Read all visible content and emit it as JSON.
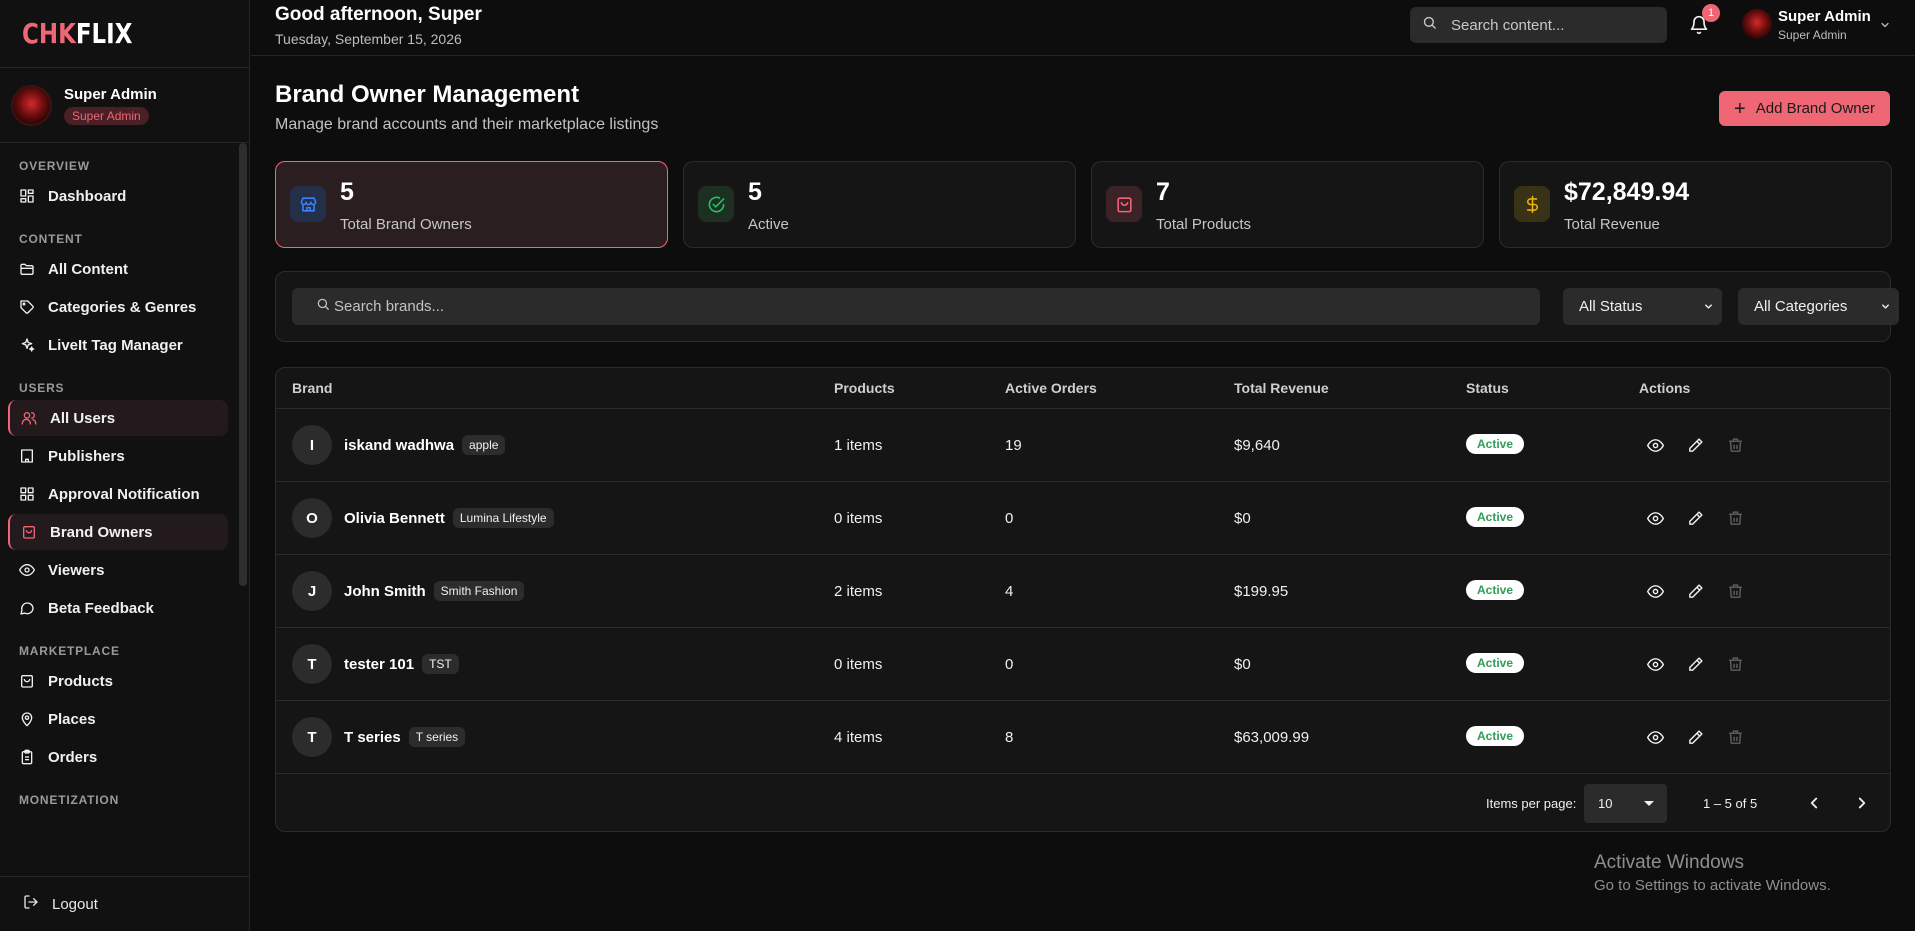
{
  "brand": {
    "logo_part1": "CHK",
    "logo_part2": "FLIX"
  },
  "profile": {
    "name": "Super Admin",
    "role": "Super Admin"
  },
  "sidebar": {
    "sections": [
      {
        "title": "OVERVIEW",
        "items": [
          {
            "label": "Dashboard",
            "icon": "dashboard-icon"
          }
        ]
      },
      {
        "title": "CONTENT",
        "items": [
          {
            "label": "All Content",
            "icon": "folder-icon"
          },
          {
            "label": "Categories & Genres",
            "icon": "tag-icon"
          },
          {
            "label": "LiveIt Tag Manager",
            "icon": "sparkles-icon"
          }
        ]
      },
      {
        "title": "USERS",
        "items": [
          {
            "label": "All Users",
            "icon": "users-icon"
          },
          {
            "label": "Publishers",
            "icon": "building-icon"
          },
          {
            "label": "Approval Notification",
            "icon": "grid-icon"
          },
          {
            "label": "Brand Owners",
            "icon": "shopping-bag-icon"
          },
          {
            "label": "Viewers",
            "icon": "eye-icon"
          },
          {
            "label": "Beta Feedback",
            "icon": "message-icon"
          }
        ]
      },
      {
        "title": "MARKETPLACE",
        "items": [
          {
            "label": "Products",
            "icon": "bag-icon"
          },
          {
            "label": "Places",
            "icon": "map-pin-icon"
          },
          {
            "label": "Orders",
            "icon": "clipboard-icon"
          }
        ]
      },
      {
        "title": "MONETIZATION",
        "items": []
      }
    ],
    "logout_label": "Logout"
  },
  "topbar": {
    "greeting": "Good afternoon, Super",
    "date": "Tuesday, September 15, 2026",
    "search_placeholder": "Search content...",
    "notification_count": "1",
    "user_name": "Super Admin",
    "user_role": "Super Admin"
  },
  "page": {
    "title": "Brand Owner Management",
    "subtitle": "Manage brand accounts and their marketplace listings",
    "add_button": "Add Brand Owner"
  },
  "stats": [
    {
      "value": "5",
      "label": "Total Brand Owners",
      "icon": "store-icon",
      "color": "#3b82f6"
    },
    {
      "value": "5",
      "label": "Active",
      "icon": "check-circle-icon",
      "color": "#22c55e"
    },
    {
      "value": "7",
      "label": "Total Products",
      "icon": "shopping-bag-icon",
      "color": "#ef6674"
    },
    {
      "value": "$72,849.94",
      "label": "Total Revenue",
      "icon": "dollar-icon",
      "color": "#eab308"
    }
  ],
  "filters": {
    "search_placeholder": "Search brands...",
    "status_select": "All Status",
    "category_select": "All Categories"
  },
  "table": {
    "columns": [
      "Brand",
      "Products",
      "Active Orders",
      "Total Revenue",
      "Status",
      "Actions"
    ],
    "rows": [
      {
        "initial": "I",
        "name": "iskand wadhwa",
        "tag": "apple",
        "products": "1 items",
        "orders": "19",
        "revenue": "$9,640",
        "status": "Active"
      },
      {
        "initial": "O",
        "name": "Olivia Bennett",
        "tag": "Lumina Lifestyle",
        "products": "0 items",
        "orders": "0",
        "revenue": "$0",
        "status": "Active"
      },
      {
        "initial": "J",
        "name": "John Smith",
        "tag": "Smith Fashion",
        "products": "2 items",
        "orders": "4",
        "revenue": "$199.95",
        "status": "Active"
      },
      {
        "initial": "T",
        "name": "tester 101",
        "tag": "TST",
        "products": "0 items",
        "orders": "0",
        "revenue": "$0",
        "status": "Active"
      },
      {
        "initial": "T",
        "name": "T series",
        "tag": "T series",
        "products": "4 items",
        "orders": "8",
        "revenue": "$63,009.99",
        "status": "Active"
      }
    ]
  },
  "pagination": {
    "items_per_page_label": "Items per page:",
    "items_per_page": "10",
    "range": "1 – 5 of 5"
  },
  "watermark": {
    "title": "Activate Windows",
    "subtitle": "Go to Settings to activate Windows."
  },
  "colors": {
    "accent": "#ef6674",
    "background": "#0d0d0d",
    "card": "#151515",
    "active_status": "#2f9e57"
  }
}
